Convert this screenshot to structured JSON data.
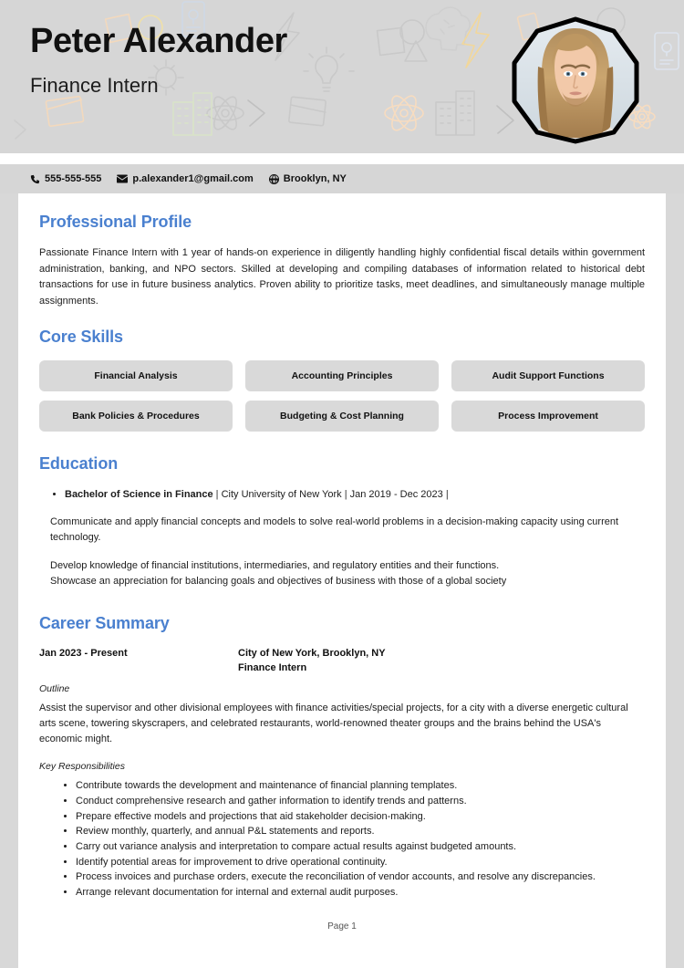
{
  "header": {
    "name": "Peter Alexander",
    "job_title": "Finance Intern",
    "accent_color": "#4a80cf",
    "banner_color": "#d6d6d6",
    "photo_alt": "portrait-photo"
  },
  "contact": {
    "phone": "555-555-555",
    "email": "p.alexander1@gmail.com",
    "location": "Brooklyn, NY",
    "phone_icon": "phone-icon",
    "email_icon": "envelope-icon",
    "location_icon": "globe-icon"
  },
  "profile": {
    "heading": "Professional Profile",
    "body": "Passionate Finance Intern with 1 year of hands-on experience in diligently handling highly confidential fiscal details within government administration, banking, and NPO sectors. Skilled at developing and compiling databases of information related to historical debt transactions for use in future business analytics. Proven ability to prioritize tasks, meet deadlines, and simultaneously manage multiple assignments."
  },
  "skills": {
    "heading": "Core Skills",
    "items": [
      "Financial Analysis",
      "Accounting Principles",
      "Audit Support Functions",
      "Bank Policies & Procedures",
      "Budgeting & Cost Planning",
      "Process Improvement"
    ]
  },
  "education": {
    "heading": "Education",
    "entries": [
      {
        "degree": "Bachelor of Science in Finance",
        "institution": "City University of New York",
        "dates": "Jan 2019 - Dec 2023",
        "separator": " | ",
        "trailing_separator": " | ",
        "paragraphs": [
          "Communicate and apply financial concepts and models to solve real-world problems in a decision-making capacity using current technology.",
          "Develop knowledge of financial institutions, intermediaries, and regulatory entities and their functions.\nShowcase an appreciation for balancing goals and objectives of business with those of a global society"
        ]
      }
    ]
  },
  "career": {
    "heading": "Career Summary",
    "jobs": [
      {
        "dates": "Jan 2023 - Present",
        "company": "City of New York, Brooklyn, NY",
        "role": "Finance Intern",
        "outline_label": "Outline",
        "outline": "Assist the supervisor and other divisional employees with finance activities/special projects, for a city with a diverse energetic cultural arts scene, towering skyscrapers, and celebrated restaurants, world-renowned theater groups and the brains behind the USA's economic might.",
        "responsibilities_label": "Key Responsibilities",
        "responsibilities": [
          "Contribute towards the development and maintenance of financial planning templates.",
          "Conduct comprehensive research and gather information to identify trends and patterns.",
          "Prepare effective models and projections that aid stakeholder decision-making.",
          "Review monthly, quarterly, and annual P&L statements and reports.",
          "Carry out variance analysis and interpretation to compare actual results against budgeted amounts.",
          "Identify potential areas for improvement to drive operational continuity.",
          "Process invoices and purchase orders, execute the reconciliation of vendor accounts, and resolve any discrepancies.",
          "Arrange relevant documentation for internal and external audit purposes."
        ]
      }
    ]
  },
  "footer": {
    "page_label": "Page 1"
  }
}
